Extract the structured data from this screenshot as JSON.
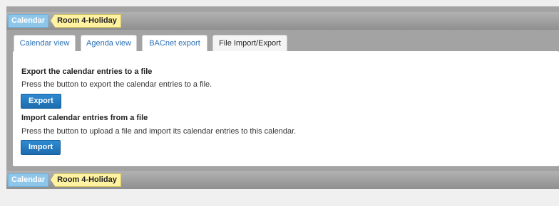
{
  "breadcrumb": {
    "root": "Calendar",
    "current": "Room 4-Holiday"
  },
  "tabs": [
    {
      "label": "Calendar view"
    },
    {
      "label": "Agenda view"
    },
    {
      "label": "BACnet export"
    },
    {
      "label": "File Import/Export",
      "active": true
    }
  ],
  "export": {
    "heading": "Export the calendar entries to a file",
    "description": "Press the button to export the calendar entries to a file.",
    "button": "Export"
  },
  "import": {
    "heading": "Import calendar entries from a file",
    "description": "Press the button to upload a file and import its calendar entries to this calendar.",
    "button": "Import"
  },
  "colors": {
    "accent": "#1d6cae",
    "breadcrumb_root": "#8ec6ea",
    "breadcrumb_current": "#fff2a0"
  }
}
